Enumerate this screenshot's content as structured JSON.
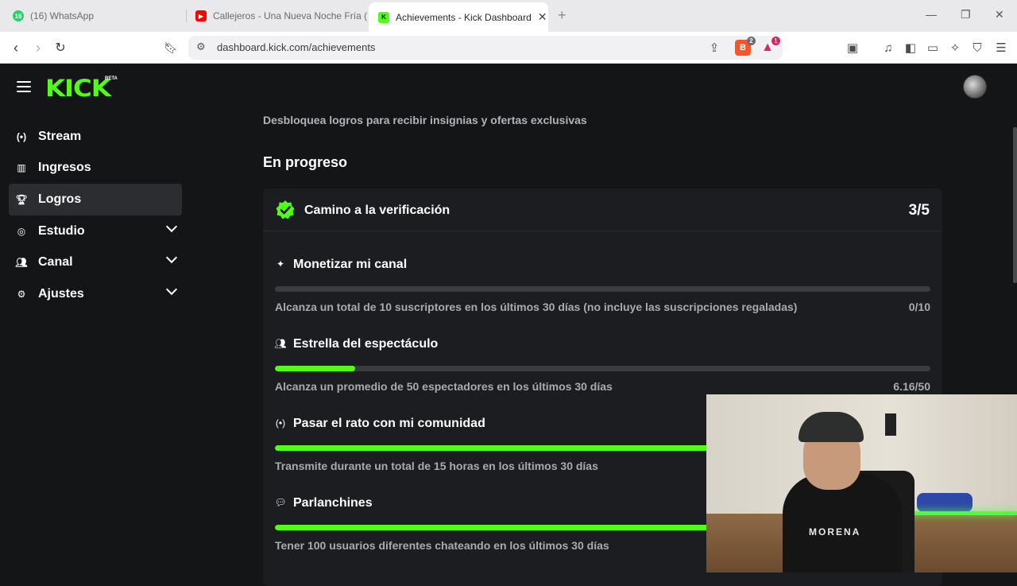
{
  "browser": {
    "tabs": [
      {
        "title": "(16) WhatsApp",
        "favicon": "whatsapp-icon",
        "badge": "16"
      },
      {
        "title": "Callejeros - Una Nueva Noche Fría (V",
        "favicon": "youtube-icon"
      },
      {
        "title": "Achievements - Kick Dashboard",
        "favicon": "kick-icon",
        "active": true
      }
    ],
    "url": "dashboard.kick.com/achievements",
    "brave_shield_count": "2",
    "rewards_count": "1"
  },
  "header": {
    "logo_text": "KICK",
    "logo_badge": "BETA"
  },
  "sidebar": {
    "items": [
      {
        "label": "Stream",
        "icon": "broadcast-icon"
      },
      {
        "label": "Ingresos",
        "icon": "chart-icon"
      },
      {
        "label": "Logros",
        "icon": "trophy-icon",
        "active": true
      },
      {
        "label": "Estudio",
        "icon": "studio-icon",
        "expandable": true
      },
      {
        "label": "Canal",
        "icon": "users-icon",
        "expandable": true
      },
      {
        "label": "Ajustes",
        "icon": "gear-icon",
        "expandable": true
      }
    ]
  },
  "main": {
    "subtitle": "Desbloquea logros para recibir insignias y ofertas exclusivas",
    "section_title": "En progreso",
    "card": {
      "title": "Camino a la verificación",
      "count": "3/5",
      "achievements": [
        {
          "title": "Monetizar mi canal",
          "icon": "sparkle-icon",
          "description": "Alcanza un total de 10 suscriptores en los últimos 30 días (no incluye las suscripciones regaladas)",
          "value": "0/10",
          "progress": 0.0
        },
        {
          "title": "Estrella del espectáculo",
          "icon": "viewers-icon",
          "description": "Alcanza un promedio de 50 espectadores en los últimos 30 días",
          "value": "6.16/50",
          "progress": 0.123
        },
        {
          "title": "Pasar el rato con mi comunidad",
          "icon": "broadcast-icon",
          "description": "Transmite durante un total de 15 horas en los últimos 30 días",
          "value": "",
          "progress": 1.0
        },
        {
          "title": "Parlanchines",
          "icon": "chat-icon",
          "description": "Tener 100 usuarios diferentes chateando en los últimos 30 días",
          "value": "",
          "progress": 1.0
        }
      ]
    }
  },
  "webcam": {
    "shirt_text": "MORENA"
  },
  "colors": {
    "accent": "#53fc18",
    "background": "#141517",
    "card": "#1c1d20"
  }
}
